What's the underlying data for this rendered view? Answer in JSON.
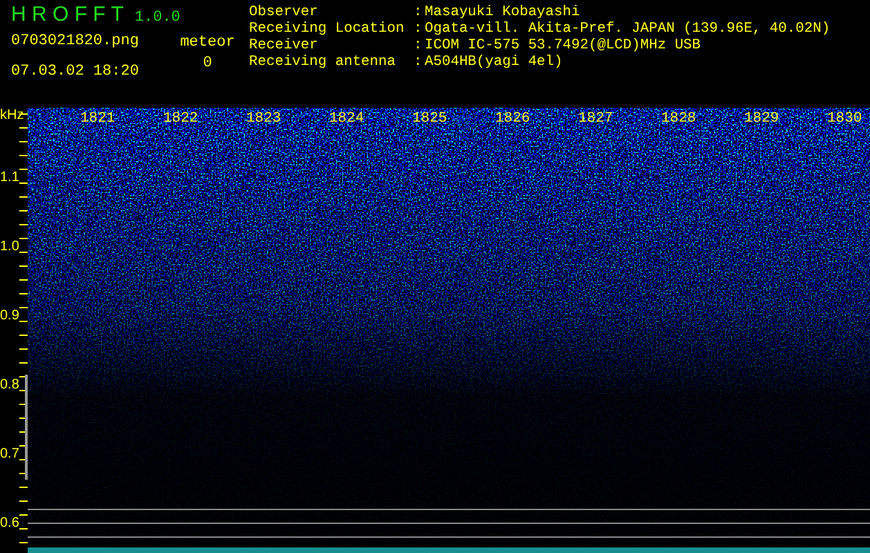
{
  "app": {
    "title": "H R O F F T",
    "version": "1.0.0"
  },
  "file": {
    "name": "0703021820.png",
    "datetime": "07.03.02 18:20"
  },
  "meteor": {
    "label": "meteor",
    "count": "0"
  },
  "station": [
    {
      "label": "Observer",
      "separator": ":",
      "value": "Masayuki Kobayashi"
    },
    {
      "label": "Receiving Location",
      "separator": ":",
      "value": "Ogata-vill. Akita-Pref. JAPAN (139.96E, 40.02N)"
    },
    {
      "label": "Receiver",
      "separator": ":",
      "value": "ICOM IC-575 53.7492(@LCD)MHz USB"
    },
    {
      "label": "Receiving antenna",
      "separator": ":",
      "value": "A504HB(yagi 4el)"
    }
  ],
  "spectrogram": {
    "unit": "kHz",
    "time_labels": [
      "1821",
      "1822",
      "1823",
      "1824",
      "1825",
      "1826",
      "1827",
      "1828",
      "1829",
      "1830"
    ],
    "freq_labels": [
      "1.1",
      "1.0",
      "0.9",
      "0.8",
      "0.7",
      "0.6"
    ]
  }
}
